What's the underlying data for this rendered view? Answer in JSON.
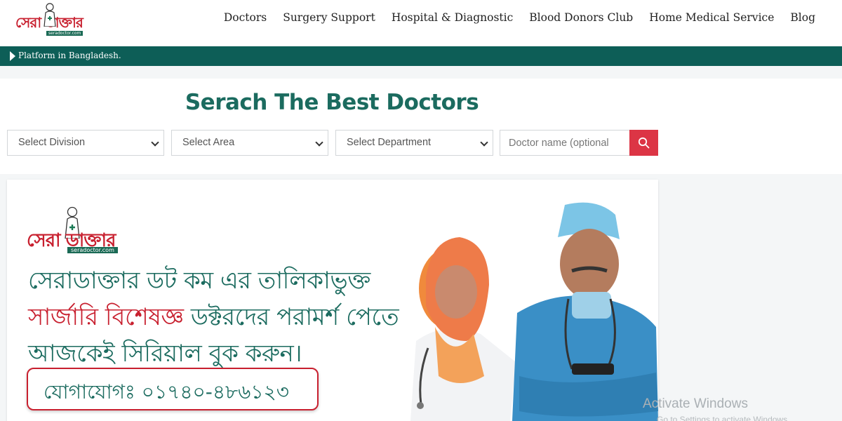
{
  "header": {
    "logo_text": "সেরা ডাক্তার",
    "logo_subtext": "seradoctor.com",
    "nav": [
      "Doctors",
      "Surgery Support",
      "Hospital & Diagnostic",
      "Blood Donors Club",
      "Home Medical Service",
      "Blog"
    ]
  },
  "ticker": {
    "text": "Platform in Bangladesh."
  },
  "search": {
    "title": "Serach The Best Doctors",
    "division_label": "Select Division",
    "area_label": "Select Area",
    "department_label": "Select Department",
    "doctor_placeholder": "Doctor name (optional",
    "search_icon": "search-icon",
    "button_color": "#dc3545"
  },
  "banner": {
    "logo_text": "সেরা ডাক্তার",
    "logo_subtext": "seradoctor.com",
    "line1": "সেরাডাক্তার ডট কম এর তালিকাভুক্ত",
    "line2_red": "সার্জারি বিশেষজ্ঞ",
    "line2_rest": " ডক্টরদের পরামর্শ পেতে",
    "line3": "আজকেই সিরিয়াল বুক করুন।",
    "contact": "যোগাযোগঃ ০১৭৪০-৪৮৬১২৩"
  },
  "overlay": {
    "watermark": "Activate Windows",
    "watermark_sub": "Go to Settings to activate Windows."
  },
  "colors": {
    "brand_green": "#0d5e57",
    "title_green": "#1b6b5f",
    "brand_red": "#c8202f"
  }
}
